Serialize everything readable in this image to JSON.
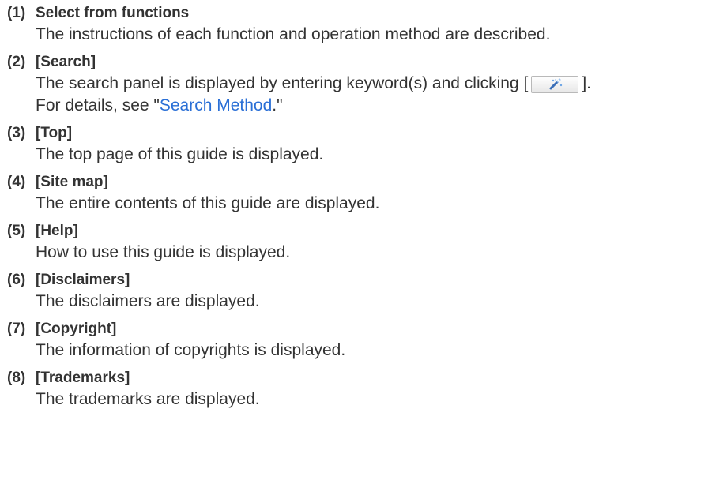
{
  "items": [
    {
      "num": "(1)",
      "title": "Select from functions",
      "desc": "The instructions of each function and operation method are described."
    },
    {
      "num": "(2)",
      "title": "[Search]",
      "desc_before": "The search panel is displayed by entering keyword(s) and clicking [",
      "desc_after": "].",
      "button_icon": "search-magic-wand-icon",
      "line2_before": "For details, see \"",
      "link": "Search Method",
      "line2_after": ".\""
    },
    {
      "num": "(3)",
      "title": "[Top]",
      "desc": "The top page of this guide is displayed."
    },
    {
      "num": "(4)",
      "title": "[Site map]",
      "desc": "The entire contents of this guide are displayed."
    },
    {
      "num": "(5)",
      "title": "[Help]",
      "desc": "How to use this guide is displayed."
    },
    {
      "num": "(6)",
      "title": "[Disclaimers]",
      "desc": "The disclaimers are displayed."
    },
    {
      "num": "(7)",
      "title": "[Copyright]",
      "desc": "The information of copyrights is displayed."
    },
    {
      "num": "(8)",
      "title": "[Trademarks]",
      "desc": "The trademarks are displayed."
    }
  ],
  "colors": {
    "text": "#333333",
    "link": "#2a6fd6"
  }
}
